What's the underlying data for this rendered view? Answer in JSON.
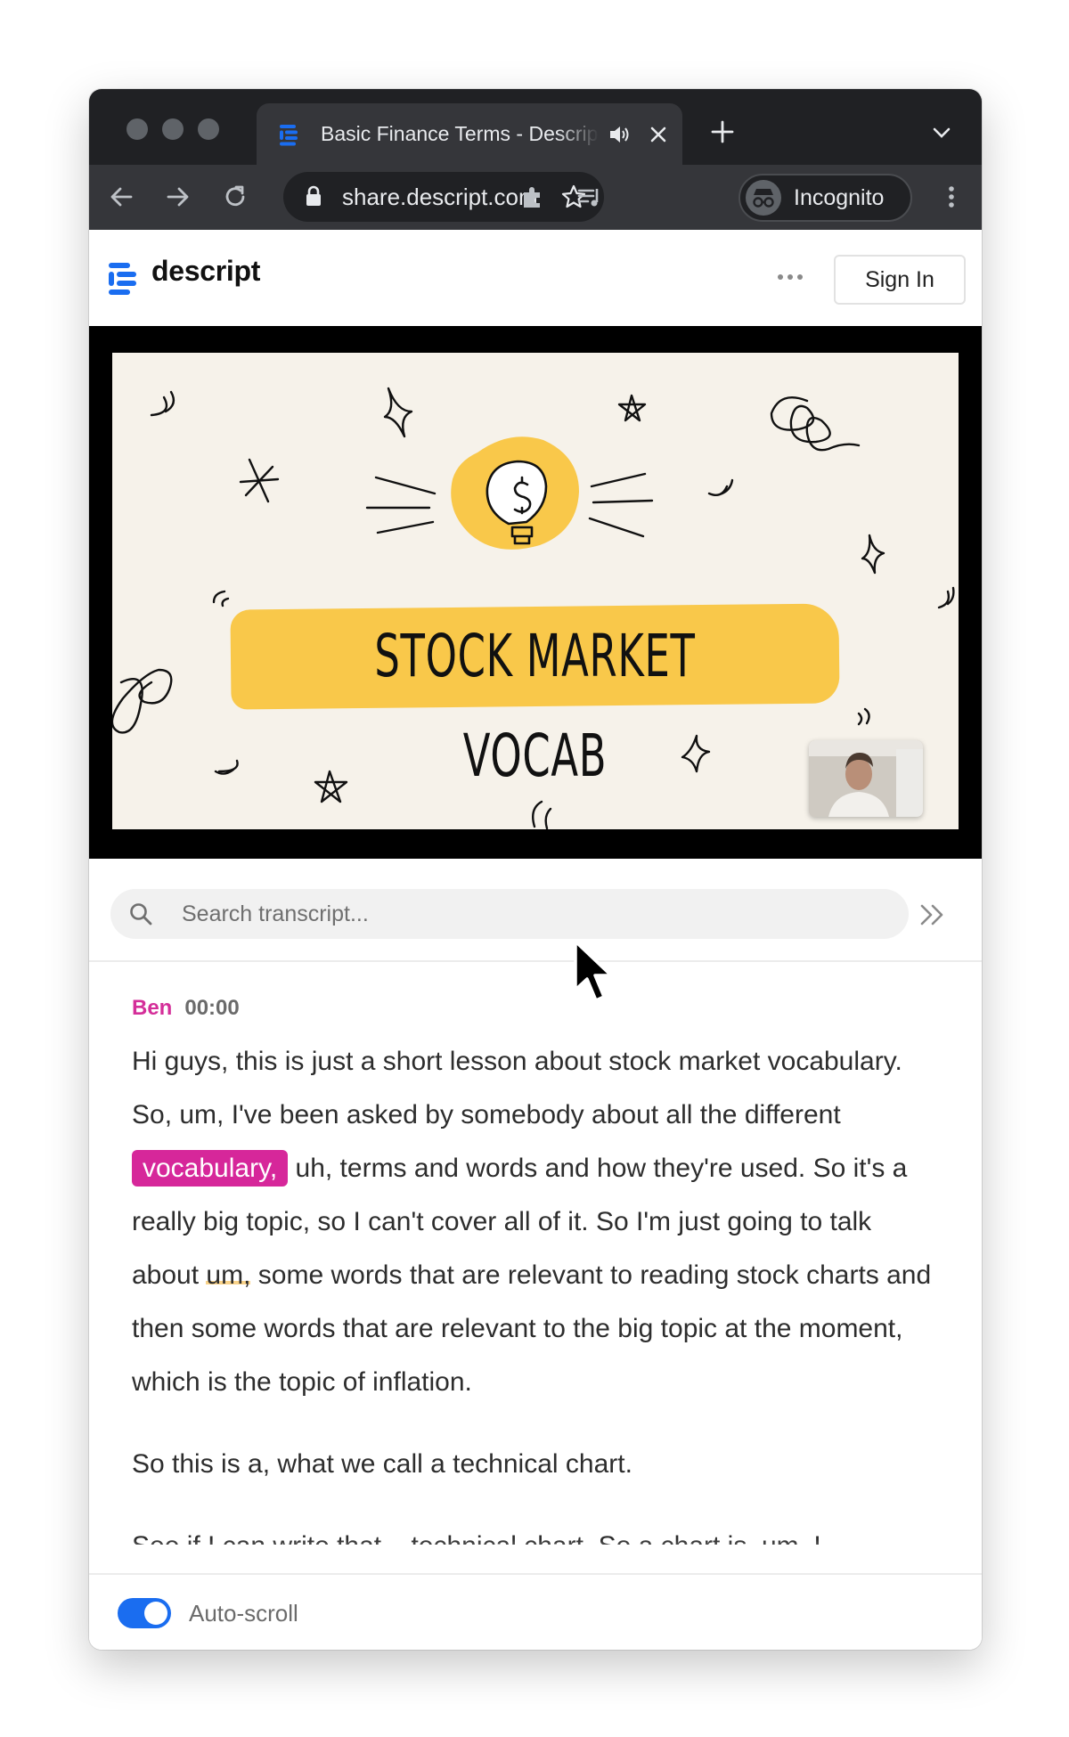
{
  "browser": {
    "tab_title": "Basic Finance Terms - Descript",
    "url": "share.descript.com",
    "profile_label": "Incognito"
  },
  "site": {
    "logo_text": "descript",
    "sign_in_label": "Sign In",
    "brand_color": "#1a6df0"
  },
  "video": {
    "slide_title": "STOCK MARKET VOCAB",
    "banner_color": "#f9c84a"
  },
  "search": {
    "placeholder": "Search transcript...",
    "value": ""
  },
  "transcript": {
    "speaker": "Ben",
    "timestamp": "00:00",
    "speaker_color": "#d42e99",
    "p1": {
      "s1": "Hi guys, this is just a short lesson about stock market vocabulary. So, um, I've been asked by somebody about all the different ",
      "highlight": "vocabulary,",
      "s2": " uh, terms and words and how they're used. So it's a really big topic, so I can't cover all of it. So I'm just going to talk about ",
      "underlined": "um,",
      "s3": " some words that are relevant to reading stock charts and then some words that are relevant to the big topic at the moment, which is the topic of inflation."
    },
    "p2": "So this is a, what we call a technical chart.",
    "p3": "See if I can write that... technical chart. So a chart is, um, I..."
  },
  "footer": {
    "autoscroll_label": "Auto-scroll",
    "autoscroll_on": true
  }
}
